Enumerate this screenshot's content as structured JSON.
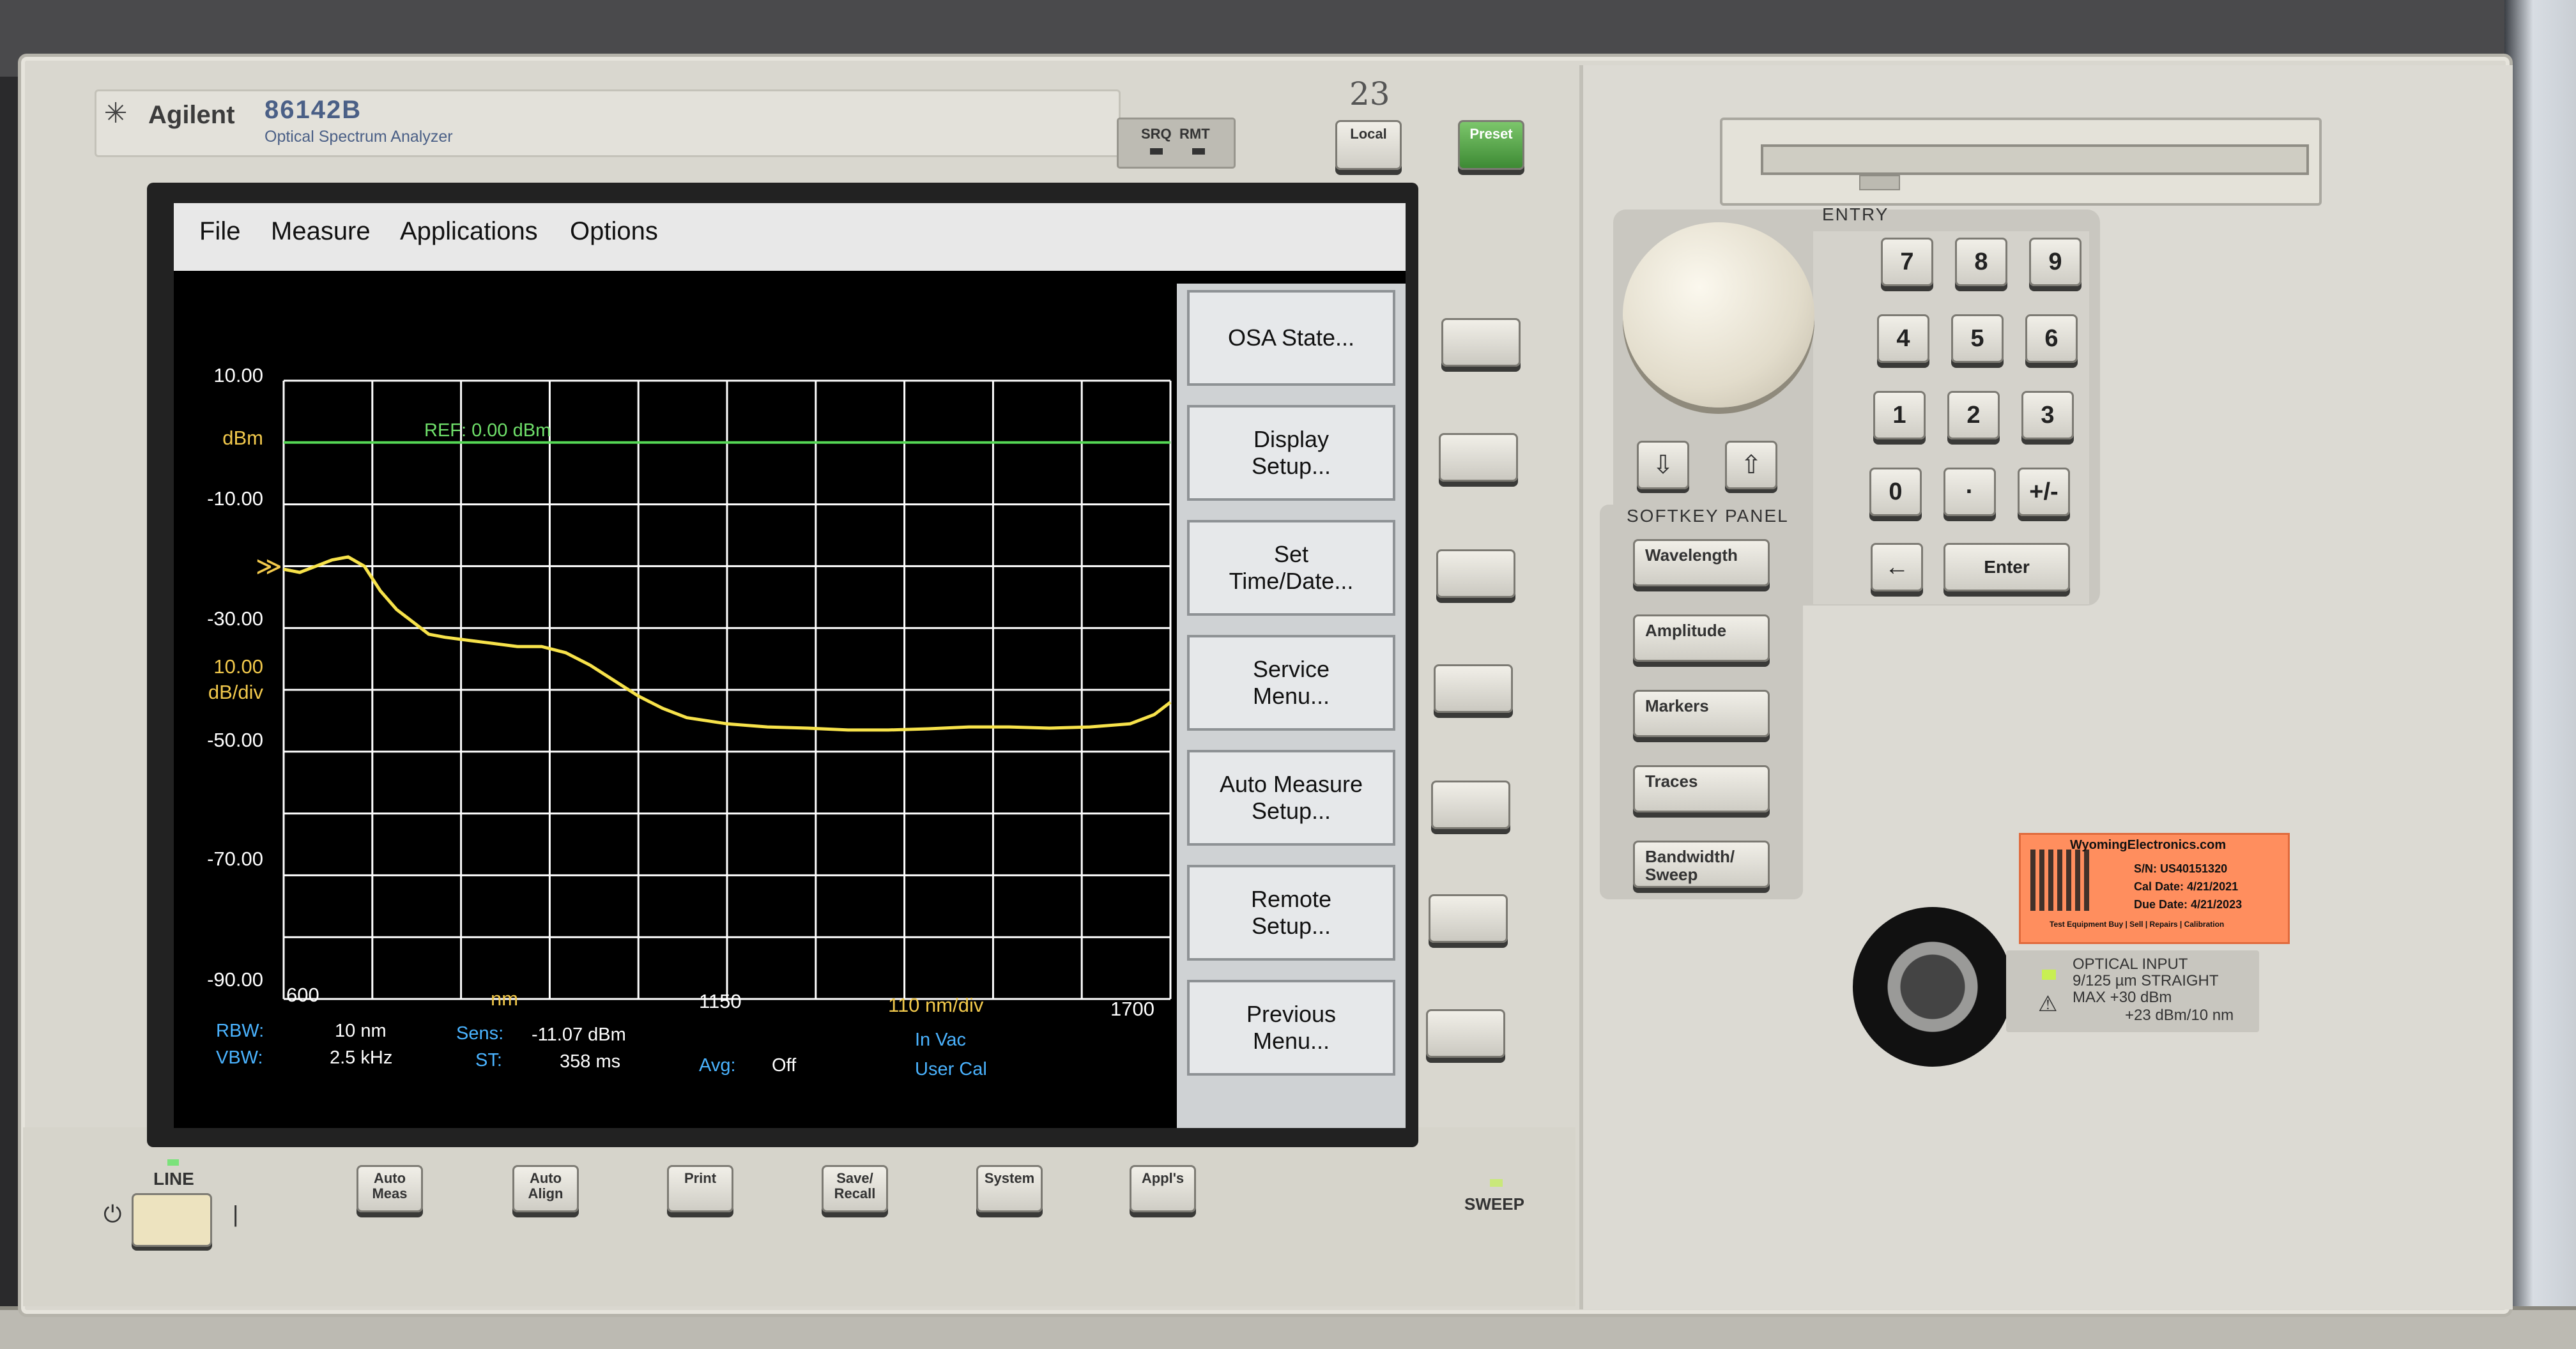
{
  "brand": {
    "name": "Agilent",
    "model": "86142B",
    "description": "Optical Spectrum Analyzer",
    "status_srq": "SRQ",
    "status_rmt": "RMT"
  },
  "handwritten_note": "23",
  "top_buttons": {
    "local": "Local",
    "preset": "Preset"
  },
  "screen": {
    "menu": [
      "File",
      "Measure",
      "Applications",
      "Options"
    ],
    "softkeys": [
      {
        "line1": "OSA State...",
        "line2": ""
      },
      {
        "line1": "Display",
        "line2": "Setup..."
      },
      {
        "line1": "Set",
        "line2": "Time/Date..."
      },
      {
        "line1": "Service",
        "line2": "Menu..."
      },
      {
        "line1": "Auto Measure",
        "line2": "Setup..."
      },
      {
        "line1": "Remote",
        "line2": "Setup..."
      },
      {
        "line1": "Previous",
        "line2": "Menu..."
      }
    ],
    "y_ticks": [
      "10.00",
      "-10.00",
      "-30.00",
      "-50.00",
      "-70.00",
      "-90.00"
    ],
    "y_unit": "dBm",
    "y_scale_line1": "10.00",
    "y_scale_line2": "dB/div",
    "ref_label": "REF: 0.00 dBm",
    "ref_marker": "≫",
    "x_ticks": [
      "600",
      "1150",
      "1700"
    ],
    "x_unit": "nm",
    "x_scale": "110 nm/div",
    "info": {
      "rbw_label": "RBW:",
      "rbw_value": "10 nm",
      "vbw_label": "VBW:",
      "vbw_value": "2.5 kHz",
      "sens_label": "Sens:",
      "sens_value": "-11.07 dBm",
      "st_label": "ST:",
      "st_value": "358 ms",
      "avg_label": "Avg:",
      "avg_value": "Off",
      "medium": "In Vac",
      "cal": "User Cal"
    }
  },
  "chart_data": {
    "type": "line",
    "xlim": [
      600,
      1700
    ],
    "ylim": [
      -90,
      10
    ],
    "x_major_step": 110,
    "y_major_step": 10,
    "reference_level": 0,
    "colors": {
      "trace": "#f7e24a",
      "grid": "#ffffff",
      "reference": "#55d855"
    },
    "series": [
      {
        "x": [
          600,
          620,
          640,
          660,
          680,
          700,
          720,
          740,
          760,
          780,
          800,
          830,
          860,
          890,
          920,
          950,
          980,
          1010,
          1040,
          1070,
          1100,
          1150,
          1200,
          1250,
          1300,
          1350,
          1400,
          1450,
          1500,
          1550,
          1600,
          1650,
          1680,
          1700
        ],
        "y": [
          -20.5,
          -21,
          -20,
          -19,
          -18.5,
          -20,
          -24,
          -27,
          -29,
          -31,
          -31.5,
          -32,
          -32.5,
          -33,
          -33,
          -34,
          -36,
          -38.5,
          -41,
          -43,
          -44.5,
          -45.5,
          -46,
          -46.2,
          -46.5,
          -46.5,
          -46.3,
          -46,
          -46,
          -46.2,
          -46,
          -45.5,
          -44,
          -42
        ]
      }
    ]
  },
  "side_buttons_count": 7,
  "bottom_buttons": [
    {
      "line1": "Auto",
      "line2": "Meas"
    },
    {
      "line1": "Auto",
      "line2": "Align"
    },
    {
      "line1": "Print",
      "line2": ""
    },
    {
      "line1": "Save/",
      "line2": "Recall"
    },
    {
      "line1": "System",
      "line2": ""
    },
    {
      "line1": "Appl's",
      "line2": ""
    }
  ],
  "line_label": "LINE",
  "power_off_symbol": "⏻",
  "power_on_symbol": "|",
  "sweep_label": "SWEEP",
  "entry_label": "ENTRY",
  "keypad": [
    "7",
    "8",
    "9",
    "4",
    "5",
    "6",
    "1",
    "2",
    "3",
    "0",
    "·",
    "+/-",
    "←",
    "Enter"
  ],
  "arrows": {
    "down": "⇩",
    "up": "⇧"
  },
  "softkey_panel": {
    "label": "SOFTKEY PANEL",
    "buttons": [
      {
        "line1": "Wavelength",
        "line2": ""
      },
      {
        "line1": "Amplitude",
        "line2": ""
      },
      {
        "line1": "Markers",
        "line2": ""
      },
      {
        "line1": "Traces",
        "line2": ""
      },
      {
        "line1": "Bandwidth/",
        "line2": "Sweep"
      }
    ]
  },
  "sticker": {
    "company": "WyomingElectronics.com",
    "sn": "S/N: US40151320",
    "cal_date": "Cal Date: 4/21/2021",
    "due_date": "Due Date: 4/21/2023",
    "footer": "Test Equipment Buy | Sell | Repairs | Calibration"
  },
  "optical_input": {
    "line1": "OPTICAL  INPUT",
    "line2": "9/125 µm  STRAIGHT",
    "line3": "MAX  +30 dBm",
    "line4": "+23 dBm/10 nm"
  }
}
